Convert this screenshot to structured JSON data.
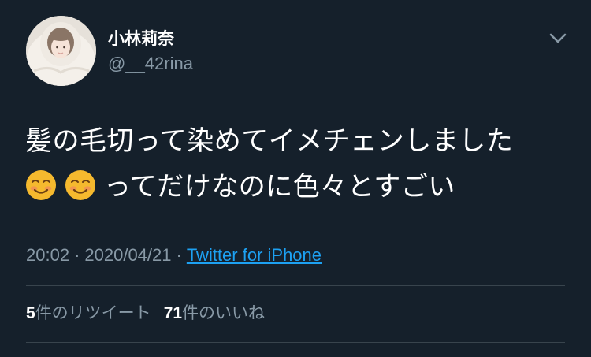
{
  "tweet": {
    "author": {
      "display_name": "小林莉奈",
      "handle": "@__42rina",
      "avatar": "profile-photo"
    },
    "text_lines": [
      "髪の毛切って染めてイメチェンしました",
      "ってだけなのに色々とすごい"
    ],
    "emoji": [
      "smiling-face-emoji",
      "smiling-face-emoji"
    ],
    "time": "20:02",
    "date": "2020/04/21",
    "separator": "·",
    "source": "Twitter for iPhone",
    "stats": {
      "retweets_count": "5",
      "retweets_label": "件のリツイート",
      "likes_count": "71",
      "likes_label": "件のいいね"
    },
    "menu_icon": "chevron-down-icon"
  },
  "colors": {
    "background": "#15202b",
    "secondary_text": "#8899a6",
    "link": "#1da1f2",
    "divider": "#38444d"
  }
}
